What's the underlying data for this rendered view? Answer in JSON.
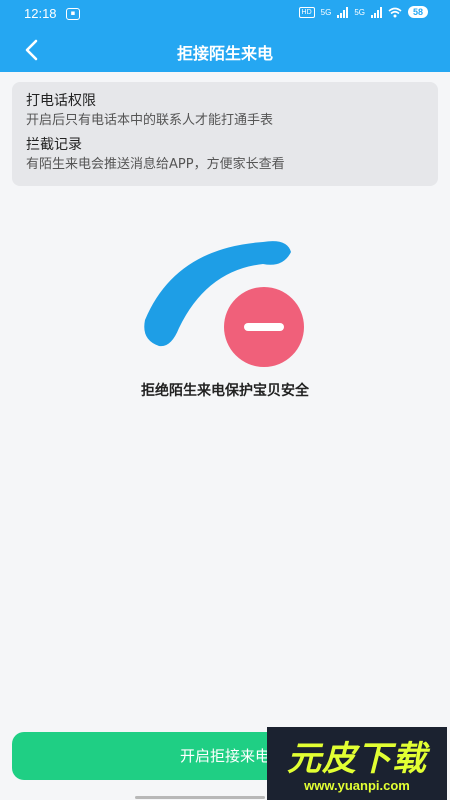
{
  "status_bar": {
    "time": "12:18",
    "notification_icon": "app-notification-icon",
    "indicators": [
      "HD",
      "5G",
      "5G"
    ],
    "battery": "58"
  },
  "nav": {
    "title": "拒接陌生来电",
    "back_icon": "chevron-left-icon"
  },
  "info_card": {
    "sections": [
      {
        "title": "打电话权限",
        "desc": "开启后只有电话本中的联系人才能打通手表"
      },
      {
        "title": "拦截记录",
        "desc": "有陌生来电会推送消息给APP，方便家长查看"
      }
    ]
  },
  "illustration": {
    "phone_icon": "phone-handset-icon",
    "block_icon": "block-minus-icon",
    "phone_color": "#1e9ee6",
    "block_color": "#f0607a"
  },
  "tagline": "拒绝陌生来电保护宝贝安全",
  "primary_button": {
    "label": "开启拒接来电",
    "color": "#1fcf84"
  },
  "watermark": {
    "main": "元皮下载",
    "sub": "www.yuanpi.com"
  },
  "colors": {
    "brand": "#25a7f2",
    "background": "#f5f6f8",
    "card": "#e6e7ea"
  }
}
